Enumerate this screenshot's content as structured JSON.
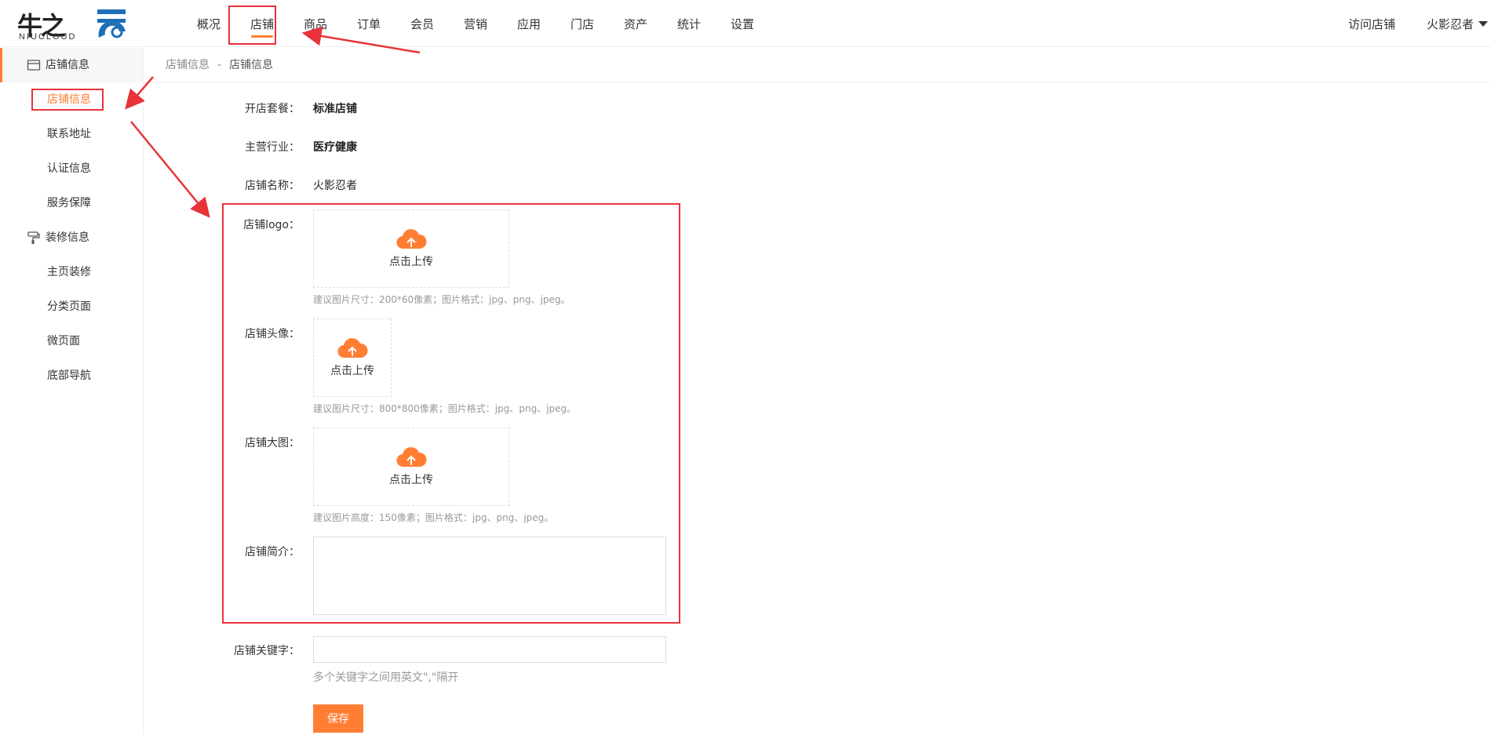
{
  "header": {
    "logo_cn": "牛之",
    "logo_en": "NIUCLOUD",
    "nav": [
      "概况",
      "店铺",
      "商品",
      "订单",
      "会员",
      "营销",
      "应用",
      "门店",
      "资产",
      "统计",
      "设置"
    ],
    "visit_store": "访问店铺",
    "username": "火影忍者"
  },
  "sidebar": {
    "group1": "店铺信息",
    "group1_items": [
      "店铺信息",
      "联系地址",
      "认证信息",
      "服务保障"
    ],
    "group2": "装修信息",
    "group2_items": [
      "主页装修",
      "分类页面",
      "微页面",
      "底部导航"
    ]
  },
  "breadcrumb": {
    "parent": "店铺信息",
    "sep": "-",
    "current": "店铺信息"
  },
  "form": {
    "package_label": "开店套餐：",
    "package_value": "标准店铺",
    "industry_label": "主营行业：",
    "industry_value": "医疗健康",
    "name_label": "店铺名称：",
    "name_value": "火影忍者",
    "logo_label": "店铺logo：",
    "upload_text": "点击上传",
    "logo_hint": "建议图片尺寸：200*60像素；图片格式：jpg、png、jpeg。",
    "avatar_label": "店铺头像：",
    "avatar_hint": "建议图片尺寸：800*800像素；图片格式：jpg、png、jpeg。",
    "banner_label": "店铺大图：",
    "banner_hint": "建议图片高度：150像素；图片格式：jpg、png、jpeg。",
    "intro_label": "店铺简介：",
    "keyword_label": "店铺关键字：",
    "keyword_hint": "多个关键字之间用英文\",\"隔开",
    "save": "保存"
  },
  "colors": {
    "accent": "#ff7e34",
    "annotation": "#e8333a"
  }
}
